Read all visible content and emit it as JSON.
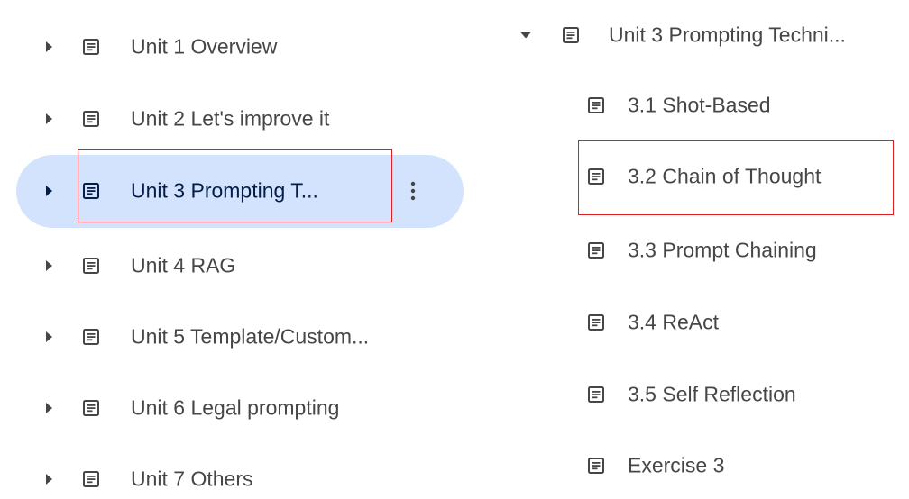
{
  "left_tree": {
    "items": [
      {
        "label": "Unit 1 Overview",
        "expanded": false,
        "selected": false
      },
      {
        "label": "Unit 2 Let's improve it",
        "expanded": false,
        "selected": false
      },
      {
        "label": "Unit 3 Prompting T...",
        "expanded": false,
        "selected": true
      },
      {
        "label": "Unit 4 RAG",
        "expanded": false,
        "selected": false
      },
      {
        "label": "Unit 5 Template/Custom...",
        "expanded": false,
        "selected": false
      },
      {
        "label": "Unit 6 Legal prompting",
        "expanded": false,
        "selected": false
      },
      {
        "label": "Unit 7 Others",
        "expanded": false,
        "selected": false
      }
    ]
  },
  "right_tree": {
    "parent": {
      "label": "Unit 3 Prompting Techni...",
      "expanded": true
    },
    "children": [
      {
        "label": "3.1 Shot-Based"
      },
      {
        "label": "3.2 Chain of Thought"
      },
      {
        "label": "3.3 Prompt Chaining"
      },
      {
        "label": "3.4 ReAct"
      },
      {
        "label": "3.5 Self Reflection"
      },
      {
        "label": "Exercise 3"
      }
    ]
  },
  "colors": {
    "text": "#444746",
    "selected_text": "#041e49",
    "selected_bg": "#d3e3fd",
    "highlight_border": "#e02020"
  },
  "icons": {
    "collapsed": "caret-right-icon",
    "expanded": "caret-down-icon",
    "document": "document-icon",
    "more": "more-vert-icon"
  }
}
